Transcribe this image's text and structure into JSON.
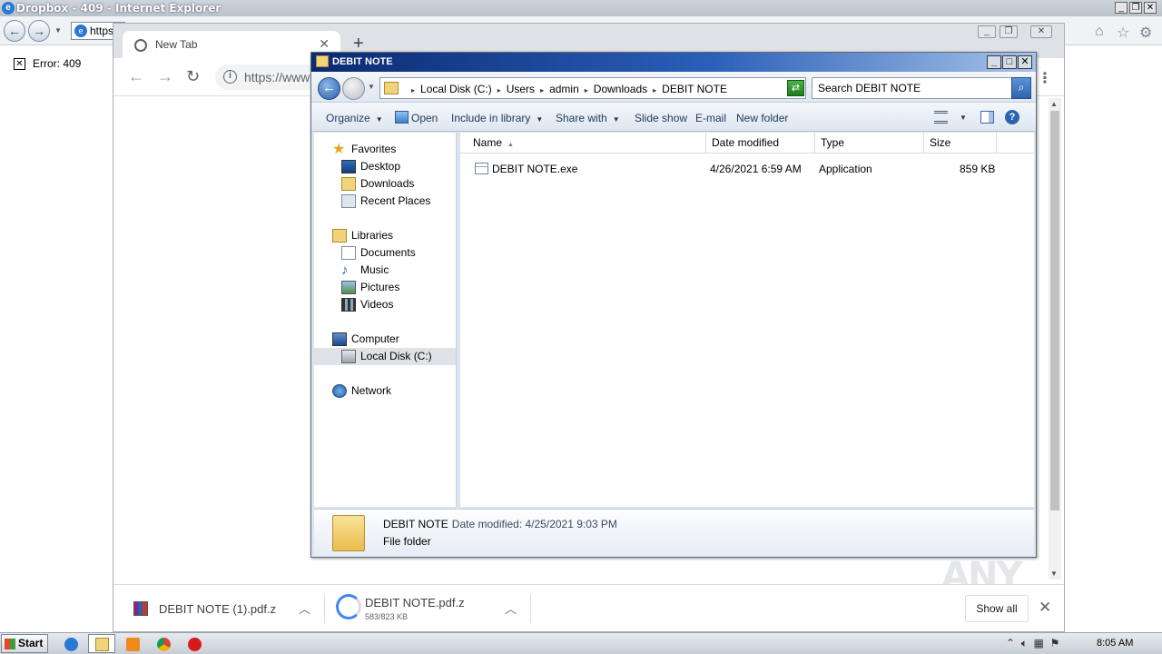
{
  "ie": {
    "title": "Dropbox - 409 - Internet Explorer",
    "address_value": "https",
    "error_text": "Error: 409"
  },
  "chrome": {
    "tab_label": "New Tab",
    "omnibox_value": "https://www",
    "downloads": [
      {
        "name": "DEBIT NOTE (1).pdf.z"
      },
      {
        "name": "DEBIT NOTE.pdf.z",
        "progress": "583/823 KB"
      }
    ],
    "show_all_label": "Show all",
    "watermark": "ANY RUN"
  },
  "explorer": {
    "title": "DEBIT NOTE",
    "breadcrumb": [
      "Local Disk (C:)",
      "Users",
      "admin",
      "Downloads",
      "DEBIT NOTE"
    ],
    "search_placeholder": "Search DEBIT NOTE",
    "commands": {
      "organize": "Organize",
      "open": "Open",
      "include": "Include in library",
      "share": "Share with",
      "slideshow": "Slide show",
      "email": "E-mail",
      "newfolder": "New folder"
    },
    "nav": {
      "favorites": "Favorites",
      "desktop": "Desktop",
      "downloads": "Downloads",
      "recent": "Recent Places",
      "libraries": "Libraries",
      "documents": "Documents",
      "music": "Music",
      "pictures": "Pictures",
      "videos": "Videos",
      "computer": "Computer",
      "localdisk": "Local Disk (C:)",
      "network": "Network"
    },
    "columns": {
      "name": "Name",
      "date": "Date modified",
      "type": "Type",
      "size": "Size"
    },
    "files": [
      {
        "name": "DEBIT NOTE.exe",
        "date": "4/26/2021 6:59 AM",
        "type": "Application",
        "size": "859 KB"
      }
    ],
    "details": {
      "name": "DEBIT NOTE",
      "date_label": "Date modified: 4/25/2021 9:03 PM",
      "type": "File folder"
    }
  },
  "taskbar": {
    "start_label": "Start",
    "clock": "8:05 AM"
  }
}
